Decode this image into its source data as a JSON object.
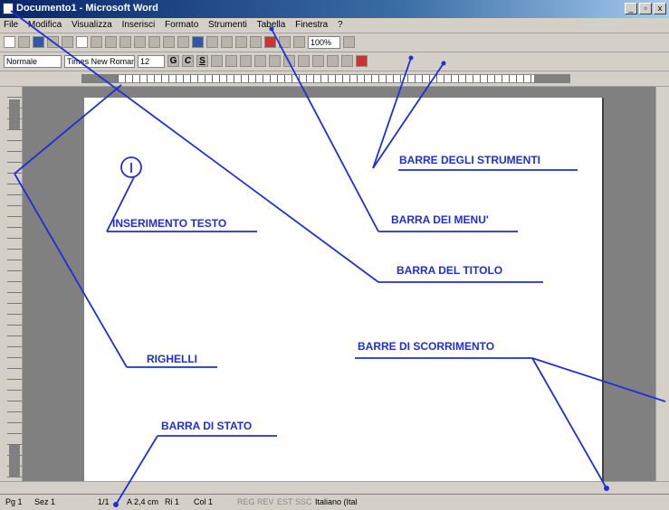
{
  "window": {
    "title": "Documento1 - Microsoft Word",
    "controls": [
      "_",
      "▫",
      "x"
    ]
  },
  "menubar": {
    "items": [
      "File",
      "Modifica",
      "Visualizza",
      "Inserisci",
      "Formato",
      "Strumenti",
      "Tabella",
      "Finestra",
      "?"
    ]
  },
  "formatting": {
    "style": "Normale",
    "font": "Times New Roman",
    "size": "12",
    "bold": "G",
    "italic": "C",
    "underline": "S"
  },
  "standard": {
    "zoom": "100%"
  },
  "statusbar": {
    "page": "Pg 1",
    "section": "Sez 1",
    "pages": "1/1",
    "position": "A 2,4 cm",
    "line": "Ri 1",
    "column": "Col 1",
    "modes": [
      "REG",
      "REV",
      "EST",
      "SSC"
    ],
    "language": "Italiano (Ital"
  },
  "annotations": {
    "barre_strumenti": "BARRE DEGLI STRUMENTI",
    "barra_menu": "BARRA DEI MENU'",
    "barra_titolo": "BARRA DEL TITOLO",
    "inserimento_testo": "INSERIMENTO TESTO",
    "righelli": "RIGHELLI",
    "barre_scorrimento": "BARRE DI SCORRIMENTO",
    "barra_stato": "BARRA DI STATO"
  },
  "colors": {
    "annotation": "#1f2fd6",
    "title_gradient_start": "#0a246a",
    "chrome": "#d4d0c8"
  }
}
